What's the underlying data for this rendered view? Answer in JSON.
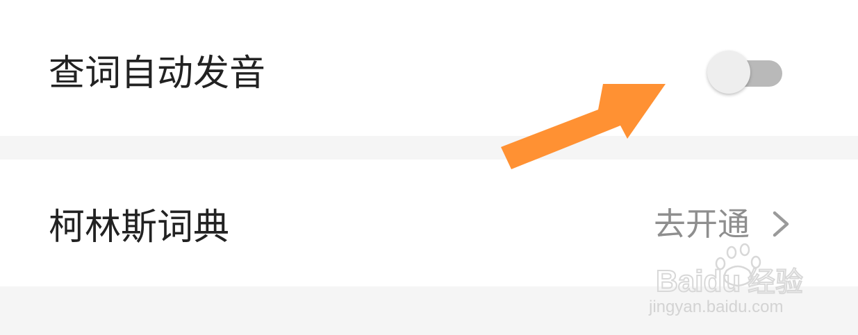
{
  "settings": {
    "auto_pronounce": {
      "label": "查词自动发音",
      "enabled": false
    },
    "collins": {
      "label": "柯林斯词典",
      "action_label": "去开通"
    }
  },
  "icons": {
    "chevron": "chevron-right-icon",
    "arrow": "annotation-arrow-icon"
  },
  "colors": {
    "background": "#f5f5f5",
    "row_background": "#ffffff",
    "label_text": "#222222",
    "secondary_text": "#8e8e8e",
    "toggle_track_off": "#b9b9b9",
    "toggle_knob": "#eeeeee",
    "annotation_arrow": "#ff9133"
  },
  "watermark": {
    "brand": "Baidu",
    "brand_cn": "经验",
    "url": "jingyan.baidu.com"
  }
}
